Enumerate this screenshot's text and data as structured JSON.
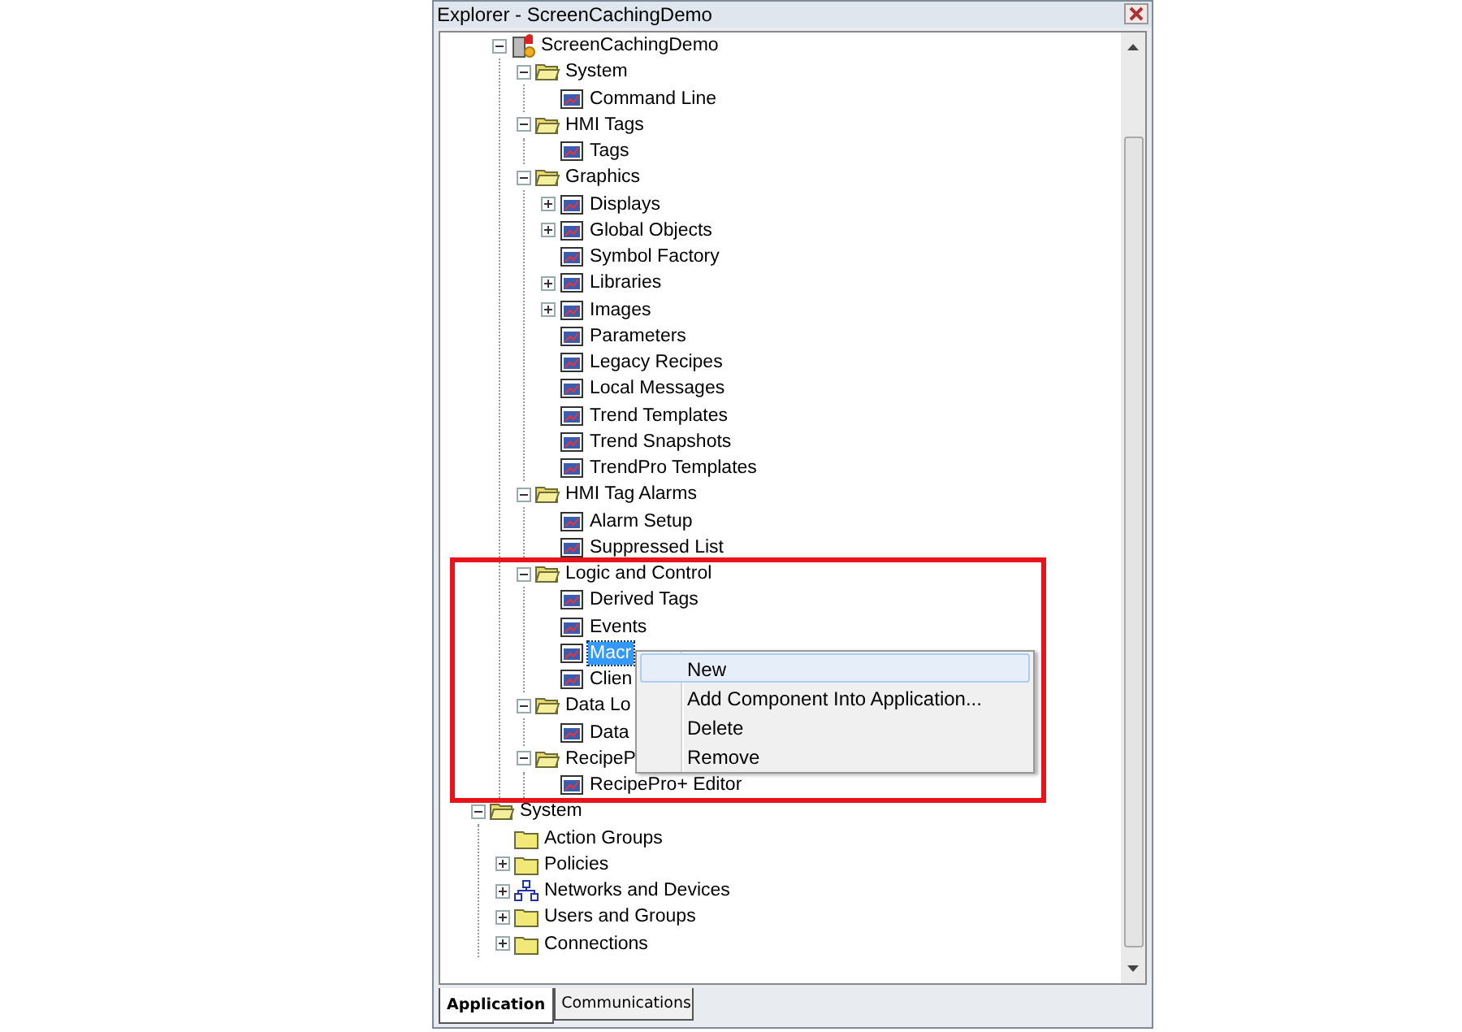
{
  "window": {
    "title": "Explorer - ScreenCachingDemo"
  },
  "tree": [
    {
      "label": "ScreenCachingDemo",
      "kind": "app",
      "expanded": true,
      "selected": false,
      "children": [
        {
          "label": "System",
          "kind": "folder",
          "expanded": true,
          "selected": false,
          "children": [
            {
              "label": "Command Line",
              "kind": "item",
              "selected": false
            }
          ]
        },
        {
          "label": "HMI Tags",
          "kind": "folder",
          "expanded": true,
          "selected": false,
          "children": [
            {
              "label": "Tags",
              "kind": "item",
              "selected": false
            }
          ]
        },
        {
          "label": "Graphics",
          "kind": "folder",
          "expanded": true,
          "selected": false,
          "children": [
            {
              "label": "Displays",
              "kind": "item",
              "expanded": false,
              "selected": false
            },
            {
              "label": "Global Objects",
              "kind": "item",
              "expanded": false,
              "selected": false
            },
            {
              "label": "Symbol Factory",
              "kind": "item",
              "selected": false
            },
            {
              "label": "Libraries",
              "kind": "item",
              "expanded": false,
              "selected": false
            },
            {
              "label": "Images",
              "kind": "item",
              "expanded": false,
              "selected": false
            },
            {
              "label": "Parameters",
              "kind": "item",
              "selected": false
            },
            {
              "label": "Legacy Recipes",
              "kind": "item",
              "selected": false
            },
            {
              "label": "Local Messages",
              "kind": "item",
              "selected": false
            },
            {
              "label": "Trend Templates",
              "kind": "item",
              "selected": false
            },
            {
              "label": "Trend Snapshots",
              "kind": "item",
              "selected": false
            },
            {
              "label": "TrendPro Templates",
              "kind": "item",
              "selected": false
            }
          ]
        },
        {
          "label": "HMI Tag Alarms",
          "kind": "folder",
          "expanded": true,
          "selected": false,
          "children": [
            {
              "label": "Alarm Setup",
              "kind": "item",
              "selected": false
            },
            {
              "label": "Suppressed List",
              "kind": "item",
              "selected": false
            }
          ]
        },
        {
          "label": "Logic and Control",
          "kind": "folder",
          "expanded": true,
          "selected": false,
          "children": [
            {
              "label": "Derived Tags",
              "kind": "item",
              "selected": false
            },
            {
              "label": "Events",
              "kind": "item",
              "selected": false
            },
            {
              "label": "Macr",
              "kind": "item",
              "selected": true
            },
            {
              "label": "Clien",
              "kind": "item",
              "selected": false
            }
          ]
        },
        {
          "label": "Data Lo",
          "kind": "folder",
          "expanded": true,
          "selected": false,
          "children": [
            {
              "label": "Data",
              "kind": "item",
              "selected": false
            }
          ]
        },
        {
          "label": "RecipeP",
          "kind": "folder",
          "expanded": true,
          "selected": false,
          "children": [
            {
              "label": "RecipePro+ Editor",
              "kind": "item",
              "selected": false
            }
          ]
        }
      ]
    },
    {
      "label": "System",
      "kind": "folder",
      "expanded": true,
      "selected": false,
      "children": [
        {
          "label": "Action Groups",
          "kind": "folder",
          "selected": false
        },
        {
          "label": "Policies",
          "kind": "folder",
          "expanded": false,
          "selected": false
        },
        {
          "label": "Networks and Devices",
          "kind": "network",
          "expanded": false,
          "selected": false
        },
        {
          "label": "Users and Groups",
          "kind": "folder",
          "expanded": false,
          "selected": false
        },
        {
          "label": "Connections",
          "kind": "folder",
          "expanded": false,
          "selected": false
        }
      ]
    }
  ],
  "context_menu": [
    {
      "label": "New",
      "selected": true
    },
    {
      "label": "Add Component Into Application...",
      "selected": false
    },
    {
      "label": "Delete",
      "selected": false
    },
    {
      "label": "Remove",
      "selected": false
    }
  ],
  "tabs": [
    {
      "label": "Application",
      "selected": true
    },
    {
      "label": "Communications",
      "selected": false
    }
  ]
}
